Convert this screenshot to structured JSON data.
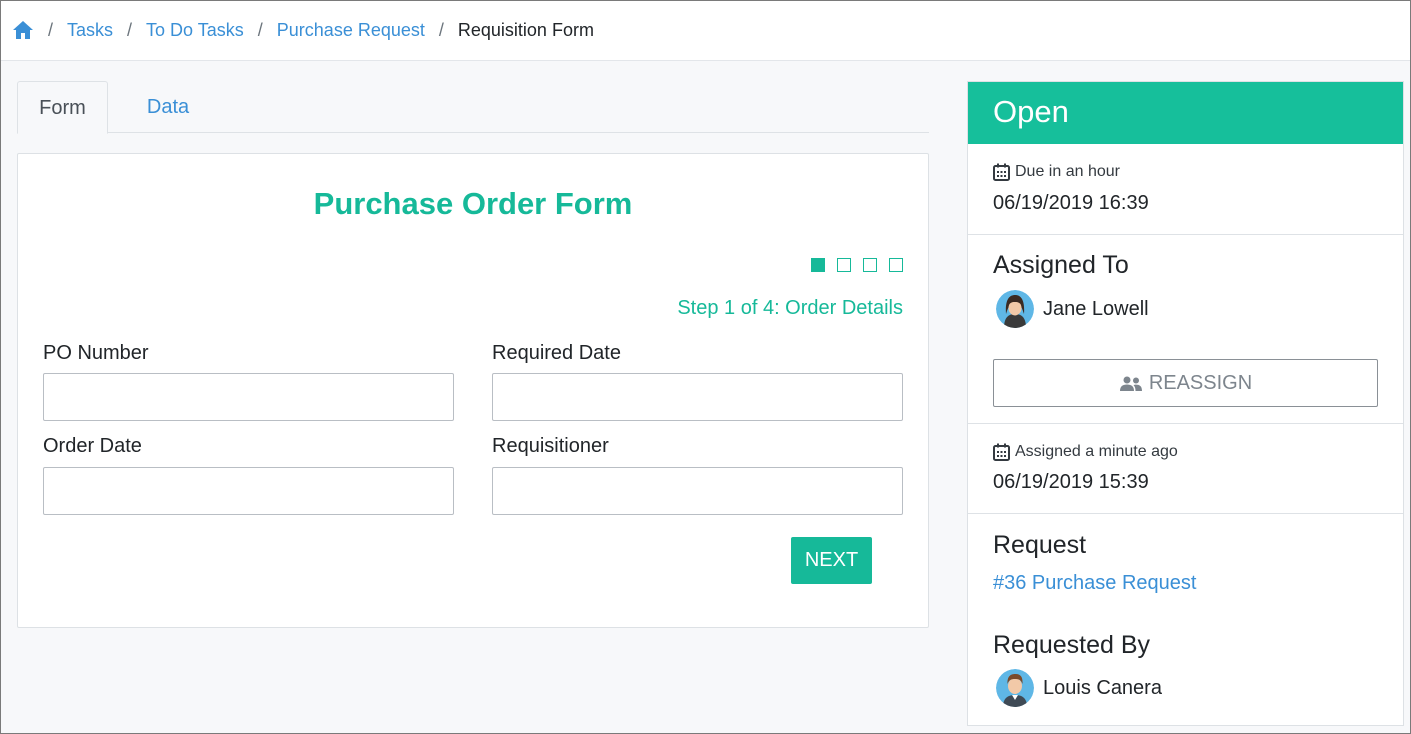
{
  "breadcrumb": {
    "home_icon": "home-icon",
    "items": [
      {
        "label": "Tasks"
      },
      {
        "label": "To Do Tasks"
      },
      {
        "label": "Purchase Request"
      }
    ],
    "current": "Requisition Form",
    "separator": "/"
  },
  "tabs": {
    "form": "Form",
    "data": "Data"
  },
  "form": {
    "title": "Purchase Order Form",
    "step_label": "Step 1 of 4: Order Details",
    "steps_total": 4,
    "step_current": 1,
    "fields": {
      "po_number": {
        "label": "PO Number",
        "value": ""
      },
      "required_date": {
        "label": "Required Date",
        "value": ""
      },
      "order_date": {
        "label": "Order Date",
        "value": ""
      },
      "requisitioner": {
        "label": "Requisitioner",
        "value": ""
      }
    },
    "next_label": "NEXT"
  },
  "panel": {
    "status": "Open",
    "due": {
      "label": "Due in an hour",
      "value": "06/19/2019 16:39"
    },
    "assigned_to": {
      "title": "Assigned To",
      "name": "Jane Lowell",
      "reassign_label": "REASSIGN"
    },
    "assigned": {
      "label": "Assigned a minute ago",
      "value": "06/19/2019 15:39"
    },
    "request": {
      "title": "Request",
      "link": "#36 Purchase Request"
    },
    "requested_by": {
      "title": "Requested By",
      "name": "Louis Canera"
    }
  },
  "colors": {
    "accent": "#16b999",
    "header": "#16bf9b",
    "link": "#3a8fd6"
  }
}
